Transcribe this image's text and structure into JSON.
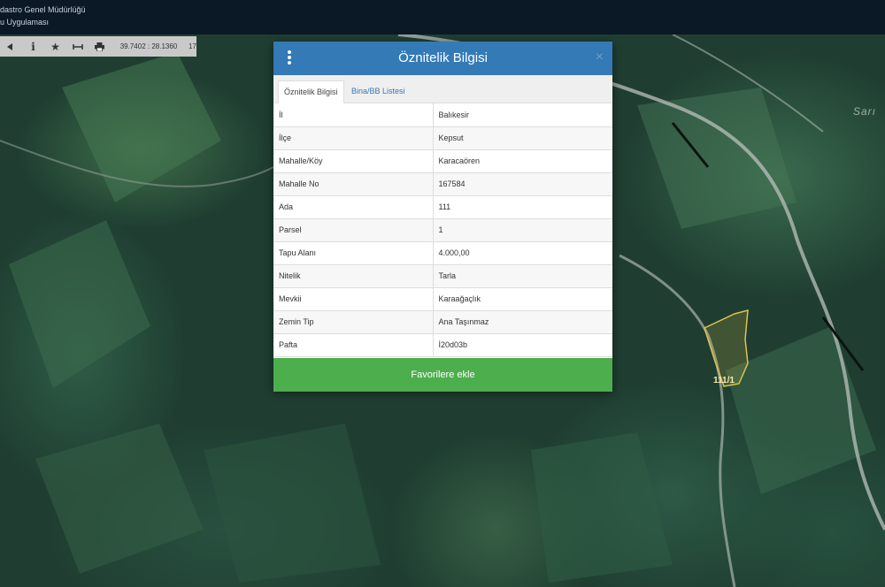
{
  "header": {
    "line1": "dastro Genel Müdürlüğü",
    "line2": "u Uygulaması"
  },
  "toolbar": {
    "coordinates": "39.7402 : 28.1360",
    "zoom": "17",
    "icons": [
      "arrow-icon",
      "info-icon",
      "star-icon",
      "measure-icon",
      "print-icon"
    ]
  },
  "map": {
    "parcel_label": "111/1",
    "place_label": "Sarı"
  },
  "modal": {
    "title": "Öznitelik Bilgisi",
    "close_label": "×",
    "tabs": [
      {
        "label": "Öznitelik Bilgisi"
      },
      {
        "label": "Bina/BB Listesi"
      }
    ],
    "rows": [
      {
        "key": "İl",
        "value": "Balıkesir"
      },
      {
        "key": "İlçe",
        "value": "Kepsut"
      },
      {
        "key": "Mahalle/Köy",
        "value": "Karacaören"
      },
      {
        "key": "Mahalle No",
        "value": "167584"
      },
      {
        "key": "Ada",
        "value": "111"
      },
      {
        "key": "Parsel",
        "value": "1"
      },
      {
        "key": "Tapu Alanı",
        "value": "4.000,00"
      },
      {
        "key": "Nitelik",
        "value": "Tarla"
      },
      {
        "key": "Mevkii",
        "value": "Karaağaçlık"
      },
      {
        "key": "Zemin Tip",
        "value": "Ana Taşınmaz"
      },
      {
        "key": "Pafta",
        "value": "İ20d03b"
      }
    ],
    "favorite_button": "Favorilere ekle"
  },
  "colors": {
    "header_bg": "#0b1826",
    "modal_head": "#337ab7",
    "favorite_button": "#4cae4c",
    "parcel_outline": "#e0c24a"
  }
}
